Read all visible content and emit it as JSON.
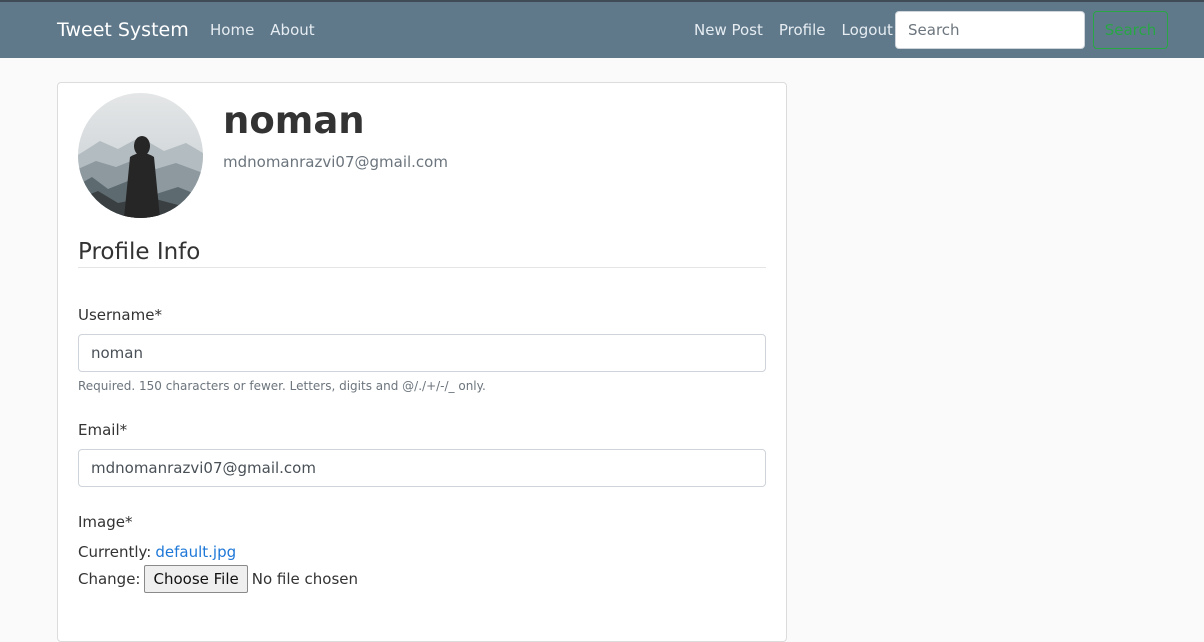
{
  "navbar": {
    "brand": "Tweet System",
    "left_links": [
      "Home",
      "About"
    ],
    "right_links": [
      "New Post",
      "Profile",
      "Logout"
    ],
    "search_placeholder": "Search",
    "search_button": "Search"
  },
  "profile": {
    "name": "noman",
    "email": "mdnomanrazvi07@gmail.com"
  },
  "form": {
    "section_title": "Profile Info",
    "username": {
      "label": "Username*",
      "value": "noman",
      "help": "Required. 150 characters or fewer. Letters, digits and @/./+/-/_ only."
    },
    "email": {
      "label": "Email*",
      "value": "mdnomanrazvi07@gmail.com"
    },
    "image": {
      "label": "Image*",
      "currently_label": "Currently:",
      "current_file": "default.jpg",
      "change_label": "Change:",
      "choose_button": "Choose File",
      "no_file_text": "No file chosen"
    }
  },
  "colors": {
    "navbar": "#5f788a",
    "accent_green": "#28a745",
    "link_blue": "#1e78d8"
  }
}
